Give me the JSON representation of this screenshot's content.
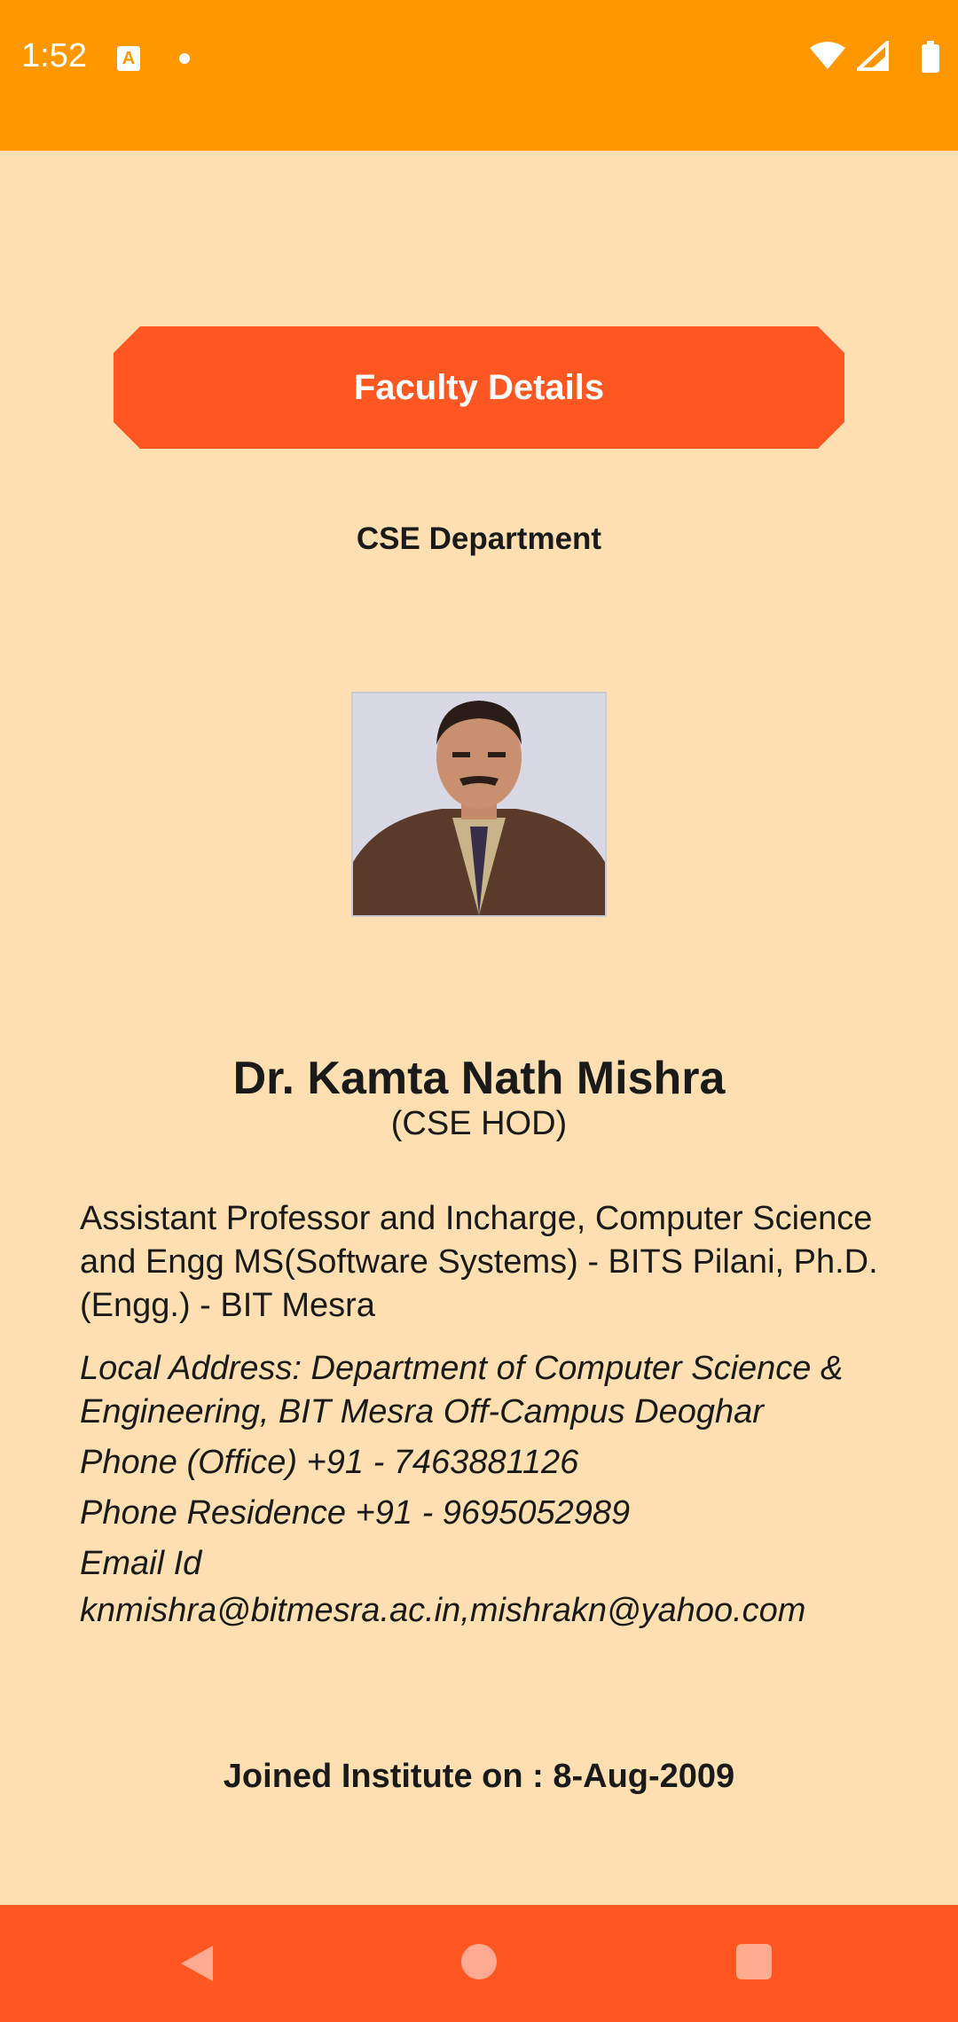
{
  "status_bar": {
    "time": "1:52",
    "icons": [
      "keyboard-a-icon",
      "notification-dot-icon",
      "wifi-icon",
      "signal-icon",
      "battery-icon"
    ],
    "color": "#FF9800"
  },
  "header": {
    "title": "Faculty Details",
    "color": "#FF5722"
  },
  "department": "CSE Department",
  "faculty": {
    "name": "Dr. Kamta Nath Mishra",
    "role": "(CSE HOD)",
    "qualification": "Assistant Professor and Incharge, Computer Science and Engg MS(Software Systems) - BITS Pilani, Ph.D.(Engg.) - BIT Mesra",
    "local_address": "Local Address: Department of Computer Science & Engineering, BIT Mesra Off-Campus Deoghar",
    "phone_office": "Phone (Office) +91 - 7463881126",
    "phone_residence": "Phone Residence +91 - 9695052989",
    "email_label": "Email Id",
    "email": "knmishra@bitmesra.ac.in,mishrakn@yahoo.com",
    "joined": "Joined Institute on : 8-Aug-2009"
  },
  "nav_bar": {
    "buttons": [
      "back-icon",
      "home-icon",
      "recents-icon"
    ],
    "color": "#FF5722"
  },
  "background_color": "#FDDFB2"
}
